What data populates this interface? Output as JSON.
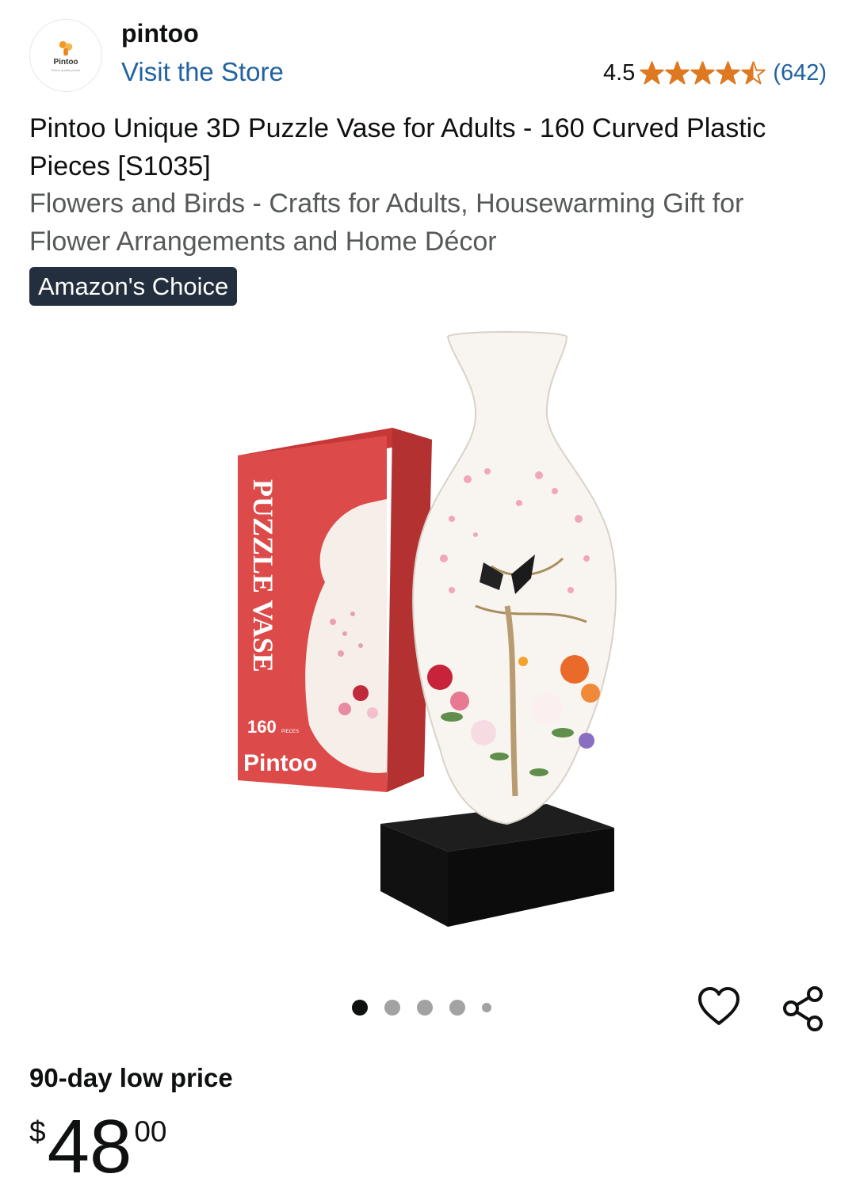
{
  "header": {
    "logo_text": "Pintoo",
    "logo_tagline": "Pintoo quality puzzle",
    "brand_name": "pintoo",
    "visit_store": "Visit the Store",
    "rating_value": "4.5",
    "rating_stars": 4.5,
    "review_count": "(642)"
  },
  "product": {
    "title": "Pintoo Unique 3D Puzzle Vase for Adults - 160 Curved Plastic Pieces [S1035]",
    "subtitle": "Flowers and Birds - Crafts for Adults, Housewarming Gift for Flower Arrangements and Home Décor",
    "badge": "Amazon's Choice",
    "box_title": "PUZZLE VASE",
    "box_count": "160",
    "box_count_unit": "PIECES",
    "box_brand": "Pintoo"
  },
  "carousel": {
    "total": 5,
    "active_index": 0
  },
  "price": {
    "label": "90-day low price",
    "symbol": "$",
    "whole": "48",
    "fraction": "00"
  },
  "colors": {
    "link": "#2162a1",
    "star": "#de7921",
    "badge_bg": "#232f3e",
    "box_red": "#dd4a4a"
  },
  "icons": {
    "wishlist": "heart-outline-icon",
    "share": "share-icon"
  }
}
